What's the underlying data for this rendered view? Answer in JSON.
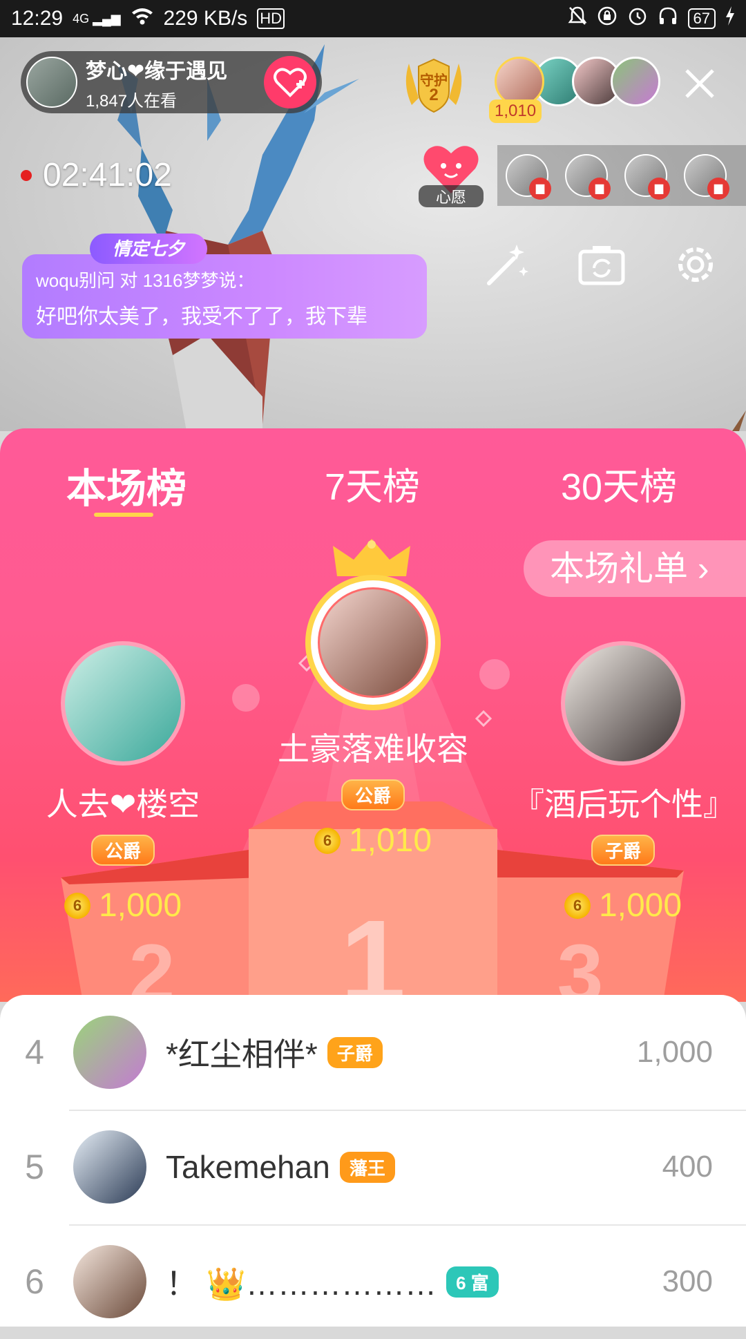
{
  "status_bar": {
    "time": "12:29",
    "network": "4G",
    "speed": "229 KB/s",
    "hd": "HD",
    "battery": "67"
  },
  "host": {
    "name": "梦心❤缘于遇见",
    "viewers": "1,847人在看"
  },
  "guard": {
    "label": "守护",
    "count": "2"
  },
  "top_viewers": {
    "badge_value": "1,010"
  },
  "live_timer": "02:41:02",
  "wish": {
    "label": "心愿"
  },
  "chat": {
    "tag": "情定七夕",
    "line1": "woqu别问 对 1316梦梦说：",
    "line2": "好吧你太美了，我受不了了，我下辈"
  },
  "tabs": [
    {
      "label": "本场榜"
    },
    {
      "label": "7天榜"
    },
    {
      "label": "30天榜"
    }
  ],
  "gift_list_button": "本场礼单 ›",
  "podium": {
    "first": {
      "name": "土豪落难收容",
      "rank_title": "公爵",
      "coins": "1,010",
      "rank_no": "1"
    },
    "second": {
      "name": "人去❤楼空",
      "rank_title": "公爵",
      "coins": "1,000",
      "rank_no": "2"
    },
    "third": {
      "name": "『酒后玩个性』",
      "rank_title": "子爵",
      "coins": "1,000",
      "rank_no": "3"
    }
  },
  "list": [
    {
      "rank": "4",
      "name": "*红尘相伴*",
      "badge": "子爵",
      "badge_color": "#ffa31a",
      "score": "1,000"
    },
    {
      "rank": "5",
      "name": "Takemehan",
      "badge": "藩王",
      "badge_color": "#ff9a1a",
      "score": "400"
    },
    {
      "rank": "6",
      "name": "！ 👑………………",
      "badge": "6 富",
      "badge_color": "#2cc7b8",
      "score": "300"
    }
  ],
  "colors": {
    "panel_top": "#ff5a98",
    "panel_bottom": "#ff6a5a",
    "accent_gold": "#ffd54a",
    "coin_text": "#ffe94a"
  }
}
